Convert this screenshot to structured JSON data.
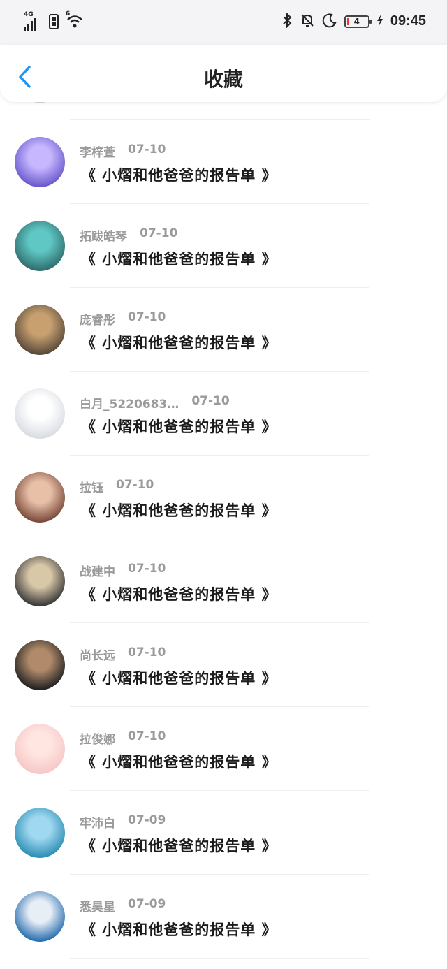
{
  "status_bar": {
    "network": "4G",
    "wifi_badge": "6",
    "battery_level": "4",
    "time": "09:45"
  },
  "header": {
    "title": "收藏"
  },
  "items": [
    {
      "name": "李梓萱",
      "date": "07-10",
      "message": "《 小熠和他爸爸的报告单 》",
      "avatar_colors": [
        "#6a5acd",
        "#c7b7ff"
      ]
    },
    {
      "name": "拓跋皓琴",
      "date": "07-10",
      "message": "《 小熠和他爸爸的报告单 》",
      "avatar_colors": [
        "#2f6f6f",
        "#5fc7c4"
      ]
    },
    {
      "name": "庞睿彤",
      "date": "07-10",
      "message": "《 小熠和他爸爸的报告单 》",
      "avatar_colors": [
        "#5a4a3a",
        "#c8a070"
      ]
    },
    {
      "name": "白月_5220683…",
      "date": "07-10",
      "message": "《 小熠和他爸爸的报告单 》",
      "avatar_colors": [
        "#d9dde3",
        "#ffffff"
      ]
    },
    {
      "name": "拉钰",
      "date": "07-10",
      "message": "《 小熠和他爸爸的报告单 》",
      "avatar_colors": [
        "#7a4a3a",
        "#e8c0a8"
      ]
    },
    {
      "name": "战建中",
      "date": "07-10",
      "message": "《 小熠和他爸爸的报告单 》",
      "avatar_colors": [
        "#3a3a3a",
        "#d9c8a8"
      ]
    },
    {
      "name": "尚长远",
      "date": "07-10",
      "message": "《 小熠和他爸爸的报告单 》",
      "avatar_colors": [
        "#222222",
        "#b08a6a"
      ]
    },
    {
      "name": "拉俊娜",
      "date": "07-10",
      "message": "《 小熠和他爸爸的报告单 》",
      "avatar_colors": [
        "#f6c8c8",
        "#ffe6e0"
      ]
    },
    {
      "name": "牢沛白",
      "date": "07-09",
      "message": "《 小熠和他爸爸的报告单 》",
      "avatar_colors": [
        "#2e8fb5",
        "#9fd8f0"
      ]
    },
    {
      "name": "悉昊星",
      "date": "07-09",
      "message": "《 小熠和他爸爸的报告单 》",
      "avatar_colors": [
        "#2a6fb0",
        "#e8eef6"
      ]
    }
  ]
}
